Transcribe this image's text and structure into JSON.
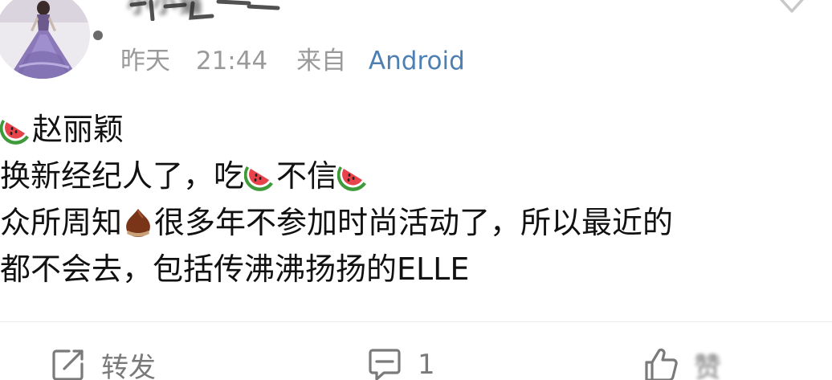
{
  "post": {
    "author": {
      "name": "小小猫"
    },
    "meta": {
      "date": "昨天",
      "time": "21:44",
      "from_label": "来自",
      "source": "Android"
    },
    "lines": [
      [
        {
          "type": "emoji",
          "name": "watermelon-emoji"
        },
        {
          "type": "text",
          "text": "赵丽颖"
        }
      ],
      [
        {
          "type": "text",
          "text": "换新经纪人了，吃"
        },
        {
          "type": "emoji",
          "name": "watermelon-emoji"
        },
        {
          "type": "text",
          "text": "不信"
        },
        {
          "type": "emoji",
          "name": "watermelon-emoji"
        }
      ],
      [
        {
          "type": "text",
          "text": "众所周知"
        },
        {
          "type": "emoji",
          "name": "chestnut-emoji"
        },
        {
          "type": "text",
          "text": "很多年不参加时尚活动了，所以最近的"
        }
      ],
      [
        {
          "type": "text",
          "text": "都不会去，包括传沸沸扬扬的ELLE"
        }
      ]
    ]
  },
  "actions": {
    "repost_label": "转发",
    "comment_count": "1",
    "like_label": "赞"
  },
  "colors": {
    "meta_gray": "#9a9a9a",
    "source_blue": "#4d7fb3",
    "action_gray": "#7a7a7a",
    "watermelon_red": "#e8424a",
    "watermelon_green": "#3f9a3a",
    "chestnut_brown": "#7a3518"
  }
}
